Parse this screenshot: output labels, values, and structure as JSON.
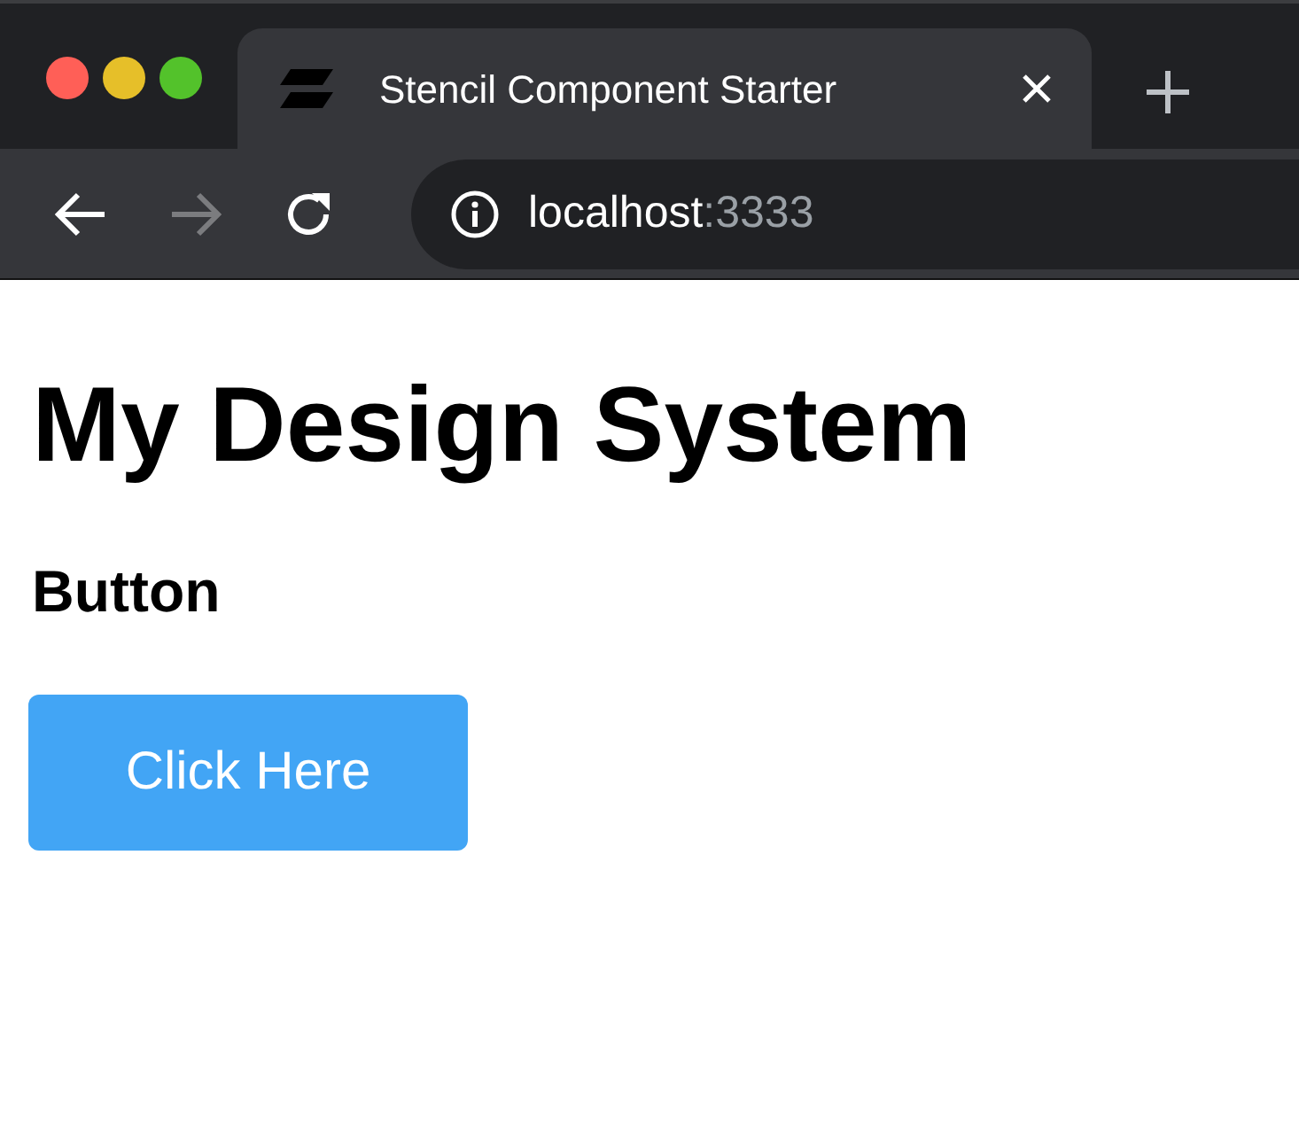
{
  "browser": {
    "tabs": [
      {
        "title": "Stencil Component Starter",
        "selected": true
      }
    ],
    "nav": [
      {
        "kind": "back",
        "disabled": false
      },
      {
        "kind": "forward",
        "disabled": true
      },
      {
        "kind": "reload",
        "disabled": false
      }
    ],
    "address": {
      "host": "localhost",
      "port": ":3333"
    }
  },
  "page": {
    "heading": "My Design System",
    "section_title": "Button",
    "button": "Click Here"
  }
}
